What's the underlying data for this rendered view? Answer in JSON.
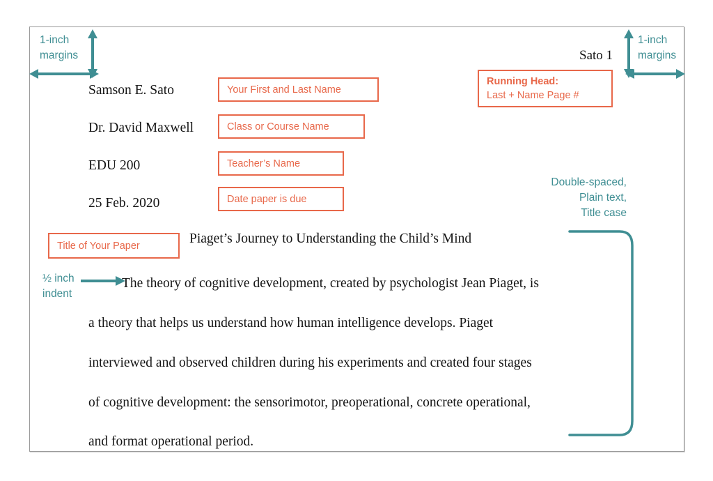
{
  "document": {
    "running_head": "Sato 1",
    "heading": {
      "name": "Samson E. Sato",
      "teacher": "Dr. David Maxwell",
      "course": "EDU 200",
      "date": "25 Feb. 2020"
    },
    "title": "Piaget’s Journey to Understanding the Child’s Mind",
    "body_lines": [
      "The theory of cognitive development, created by psychologist Jean Piaget, is",
      "a theory that helps us understand how human intelligence develops. Piaget",
      "interviewed and observed children during his experiments and created four stages",
      "of cognitive development: the sensorimotor, preoperational, concrete operational,",
      "and format operational period."
    ]
  },
  "callouts": {
    "name": "Your First and Last Name",
    "course": "Class or Course Name",
    "teacher": "Teacher’s Name",
    "date": "Date paper is due",
    "title": "Title of Your Paper",
    "running_head_title": "Running Head:",
    "running_head_detail": "Last + Name Page #"
  },
  "annotations": {
    "margins_left_line1": "1-inch",
    "margins_left_line2": "margins",
    "margins_right_line1": "1-inch",
    "margins_right_line2": "margins",
    "indent_line1": "½ inch",
    "indent_line2": "indent",
    "body_style_line1": "Double-spaced,",
    "body_style_line2": "Plain text,",
    "body_style_line3": "Title case"
  },
  "colors": {
    "teal": "#3F8E93",
    "coral": "#E8684A",
    "page_border": "#9A9A9A",
    "text": "#141414"
  }
}
